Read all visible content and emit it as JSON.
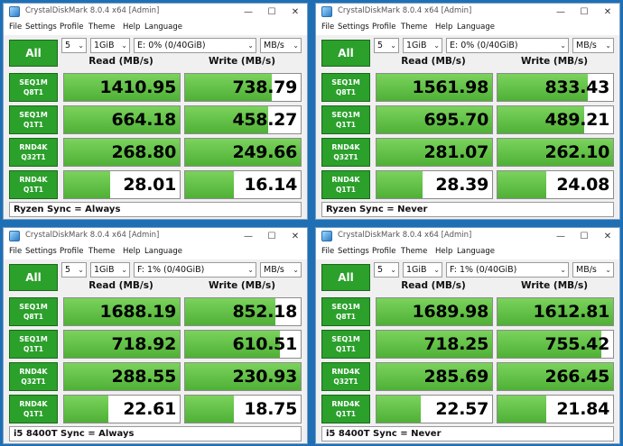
{
  "colors": {
    "desktop": "#1f6fb5",
    "accent_green": "#2ba02b",
    "bar_green": "#5cbf3e"
  },
  "windows": [
    {
      "title": "CrystalDiskMark 8.0.4 x64 [Admin]",
      "menu": [
        "File",
        "Settings",
        "Profile",
        "Theme",
        "Help",
        "Language"
      ],
      "all_label": "All",
      "count": "5",
      "size": "1GiB",
      "drive": "E: 0% (0/40GiB)",
      "unit": "MB/s",
      "read_header": "Read (MB/s)",
      "write_header": "Write (MB/s)",
      "rows": [
        {
          "label1": "SEQ1M",
          "label2": "Q8T1",
          "read": "1410.95",
          "write": "738.79",
          "read_fill": 1.0,
          "write_fill": 0.75
        },
        {
          "label1": "SEQ1M",
          "label2": "Q1T1",
          "read": "664.18",
          "write": "458.27",
          "read_fill": 1.0,
          "write_fill": 0.72
        },
        {
          "label1": "RND4K",
          "label2": "Q32T1",
          "read": "268.80",
          "write": "249.66",
          "read_fill": 1.0,
          "write_fill": 1.0
        },
        {
          "label1": "RND4K",
          "label2": "Q1T1",
          "read": "28.01",
          "write": "16.14",
          "read_fill": 0.4,
          "write_fill": 0.42
        }
      ],
      "comment": "Ryzen Sync = Always"
    },
    {
      "title": "CrystalDiskMark 8.0.4 x64 [Admin]",
      "menu": [
        "File",
        "Settings",
        "Profile",
        "Theme",
        "Help",
        "Language"
      ],
      "all_label": "All",
      "count": "5",
      "size": "1GiB",
      "drive": "E: 0% (0/40GiB)",
      "unit": "MB/s",
      "read_header": "Read (MB/s)",
      "write_header": "Write (MB/s)",
      "rows": [
        {
          "label1": "SEQ1M",
          "label2": "Q8T1",
          "read": "1561.98",
          "write": "833.43",
          "read_fill": 1.0,
          "write_fill": 0.78
        },
        {
          "label1": "SEQ1M",
          "label2": "Q1T1",
          "read": "695.70",
          "write": "489.21",
          "read_fill": 1.0,
          "write_fill": 0.75
        },
        {
          "label1": "RND4K",
          "label2": "Q32T1",
          "read": "281.07",
          "write": "262.10",
          "read_fill": 1.0,
          "write_fill": 1.0
        },
        {
          "label1": "RND4K",
          "label2": "Q1T1",
          "read": "28.39",
          "write": "24.08",
          "read_fill": 0.4,
          "write_fill": 0.42
        }
      ],
      "comment": "Ryzen Sync = Never"
    },
    {
      "title": "CrystalDiskMark 8.0.4 x64 [Admin]",
      "menu": [
        "File",
        "Settings",
        "Profile",
        "Theme",
        "Help",
        "Language"
      ],
      "all_label": "All",
      "count": "5",
      "size": "1GiB",
      "drive": "F: 1% (0/40GiB)",
      "unit": "MB/s",
      "read_header": "Read (MB/s)",
      "write_header": "Write (MB/s)",
      "rows": [
        {
          "label1": "SEQ1M",
          "label2": "Q8T1",
          "read": "1688.19",
          "write": "852.18",
          "read_fill": 1.0,
          "write_fill": 0.78
        },
        {
          "label1": "SEQ1M",
          "label2": "Q1T1",
          "read": "718.92",
          "write": "610.51",
          "read_fill": 1.0,
          "write_fill": 0.82
        },
        {
          "label1": "RND4K",
          "label2": "Q32T1",
          "read": "288.55",
          "write": "230.93",
          "read_fill": 1.0,
          "write_fill": 1.0
        },
        {
          "label1": "RND4K",
          "label2": "Q1T1",
          "read": "22.61",
          "write": "18.75",
          "read_fill": 0.38,
          "write_fill": 0.42
        }
      ],
      "comment": "i5 8400T Sync = Always"
    },
    {
      "title": "CrystalDiskMark 8.0.4 x64 [Admin]",
      "menu": [
        "File",
        "Settings",
        "Profile",
        "Theme",
        "Help",
        "Language"
      ],
      "all_label": "All",
      "count": "5",
      "size": "1GiB",
      "drive": "F: 1% (0/40GiB)",
      "unit": "MB/s",
      "read_header": "Read (MB/s)",
      "write_header": "Write (MB/s)",
      "rows": [
        {
          "label1": "SEQ1M",
          "label2": "Q8T1",
          "read": "1689.98",
          "write": "1612.81",
          "read_fill": 1.0,
          "write_fill": 1.0
        },
        {
          "label1": "SEQ1M",
          "label2": "Q1T1",
          "read": "718.25",
          "write": "755.42",
          "read_fill": 1.0,
          "write_fill": 0.9
        },
        {
          "label1": "RND4K",
          "label2": "Q32T1",
          "read": "285.69",
          "write": "266.45",
          "read_fill": 1.0,
          "write_fill": 1.0
        },
        {
          "label1": "RND4K",
          "label2": "Q1T1",
          "read": "22.57",
          "write": "21.84",
          "read_fill": 0.38,
          "write_fill": 0.42
        }
      ],
      "comment": "i5 8400T Sync = Never"
    }
  ]
}
